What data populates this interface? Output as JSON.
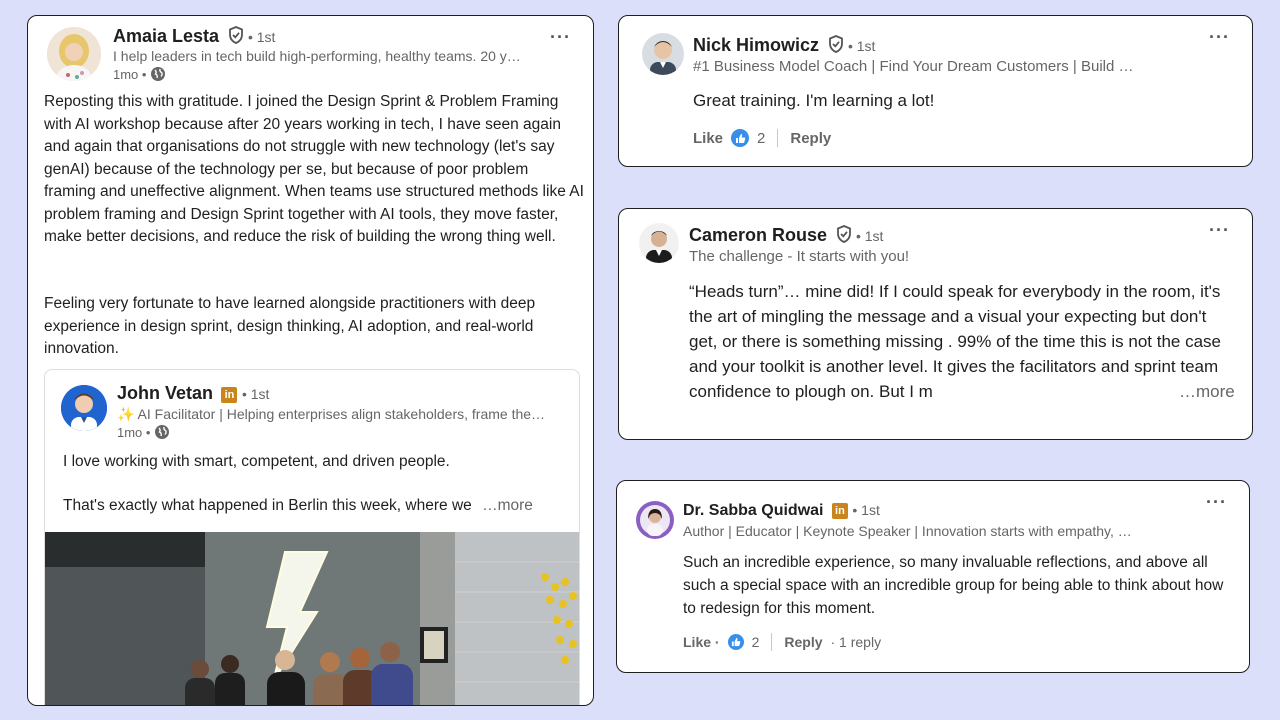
{
  "colors": {
    "background": "#dcdffa",
    "like_blue": "#378fe9",
    "linkedin_badge": "#c9841a"
  },
  "post": {
    "author": "Amaia Lesta",
    "degree": "• 1st",
    "headline": "I help leaders in tech build high-performing, healthy teams. 20 y…",
    "time": "1mo •",
    "body_p1": "Reposting this with gratitude. I joined the Design Sprint & Problem Framing with AI workshop because after 20 years working in tech, I have seen again and again that organisations do not struggle with new technology (let's say genAI) because of the technology per se, but because of poor problem framing and uneffective alignment. When teams use structured methods like AI problem framing and Design Sprint together with AI tools, they move faster, make better decisions, and reduce the risk of building the wrong thing well.",
    "body_p2": "Feeling very fortunate to have learned alongside practitioners with deep experience in design sprint, design thinking, AI adoption, and real-world innovation.",
    "icons": [
      "verified-shield-icon",
      "globe-icon",
      "more-options-icon"
    ],
    "shared": {
      "author": "John Vetan",
      "degree": "• 1st",
      "headline": "✨ AI Facilitator | Helping enterprises align stakeholders, frame the…",
      "time": "1mo •",
      "line1": "I love working with smart, competent, and driven people.",
      "line2": "That's exactly what happened in Berlin this week, where we",
      "more": "…more"
    }
  },
  "comments": [
    {
      "author": "Nick Himowicz",
      "degree": "• 1st",
      "headline": "#1 Business Model Coach | Find Your Dream Customers | Build …",
      "text": "Great training. I'm learning a lot!",
      "like": "Like",
      "count": "2",
      "reply": "Reply"
    },
    {
      "author": "Cameron Rouse",
      "degree": "• 1st",
      "headline": "The challenge - It starts with you!",
      "text": "“Heads turn”… mine did! If I could speak for everybody in the room, it's the art of mingling the message and a visual your expecting but don't get, or there is something missing . 99% of the time this is not the case and your toolkit is another level. It gives the facilitators and sprint team confidence to plough on. But I m",
      "more": "…more"
    },
    {
      "author": "Dr. Sabba Quidwai",
      "degree": "• 1st",
      "headline": "Author | Educator | Keynote Speaker | Innovation starts with empathy, …",
      "text": "Such an incredible experience, so many invaluable reflections, and above all such a special space with an incredible group for being able to think about how to redesign for this moment.",
      "like": "Like ·",
      "count": "2",
      "reply": "Reply",
      "replies": "· 1 reply"
    }
  ]
}
